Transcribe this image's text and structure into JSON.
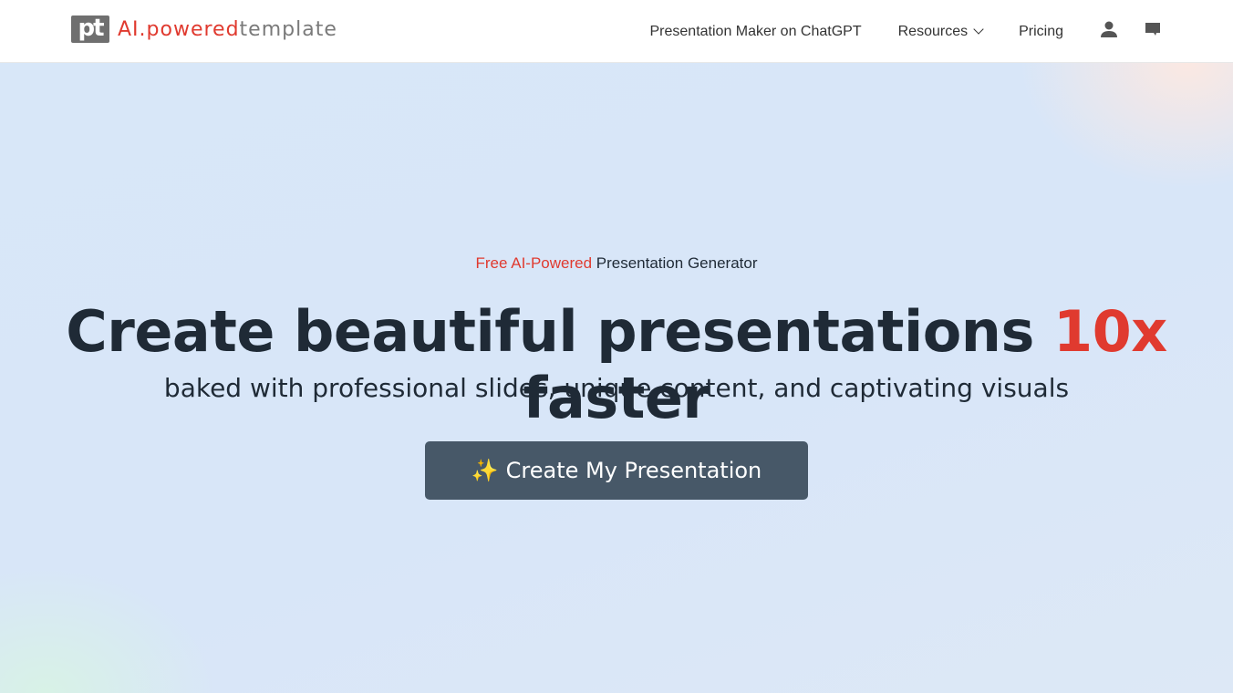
{
  "logo": {
    "mark": "pt",
    "red": "AI.powered",
    "gray": "template"
  },
  "nav": {
    "items": [
      "Presentation Maker on ChatGPT",
      "Resources",
      "Pricing"
    ],
    "user_icon": "user-icon",
    "chat_icon": "chat-icon"
  },
  "hero": {
    "tag_red": "Free AI-Powered",
    "tag_rest": " Presentation Generator",
    "title_a": "Create beautiful presentations ",
    "title_red": "10x",
    "title_b": " faster",
    "subtitle": "baked with professional slides, unique content, and captivating visuals",
    "cta_icon": "✨",
    "cta": "Create My Presentation"
  },
  "colors": {
    "accent": "#e03a2f",
    "button": "#475868"
  }
}
